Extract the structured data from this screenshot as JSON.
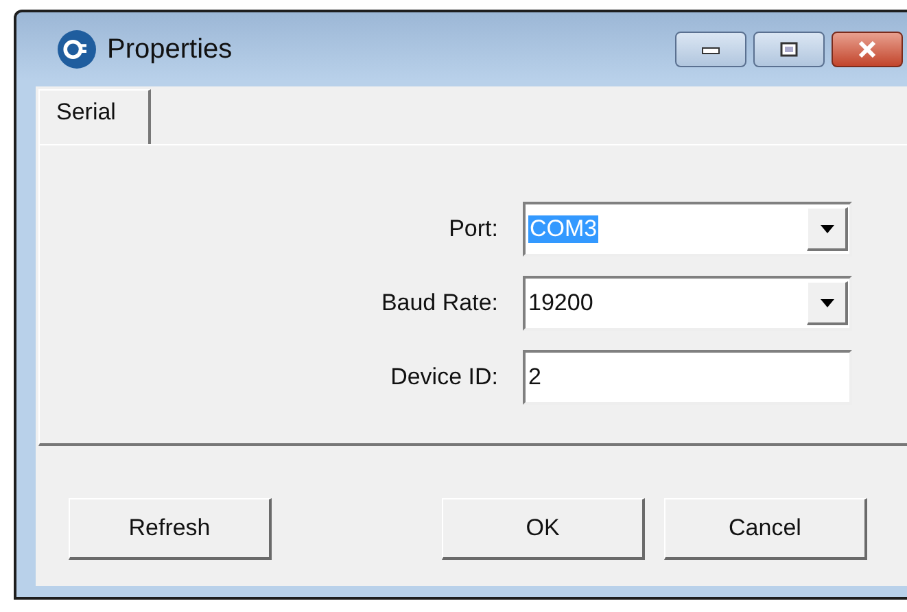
{
  "window": {
    "title": "Properties"
  },
  "tabs": [
    {
      "label": "Serial",
      "selected": true
    }
  ],
  "fields": [
    {
      "kind": "combo",
      "label": "Port:",
      "value": "COM3",
      "highlighted": true
    },
    {
      "kind": "combo",
      "label": "Baud Rate:",
      "value": "19200",
      "highlighted": false
    },
    {
      "kind": "text",
      "label": "Device ID:",
      "value": "2",
      "highlighted": false
    }
  ],
  "left_buttons": [
    "Refresh"
  ],
  "right_buttons": [
    "OK",
    "Cancel"
  ]
}
